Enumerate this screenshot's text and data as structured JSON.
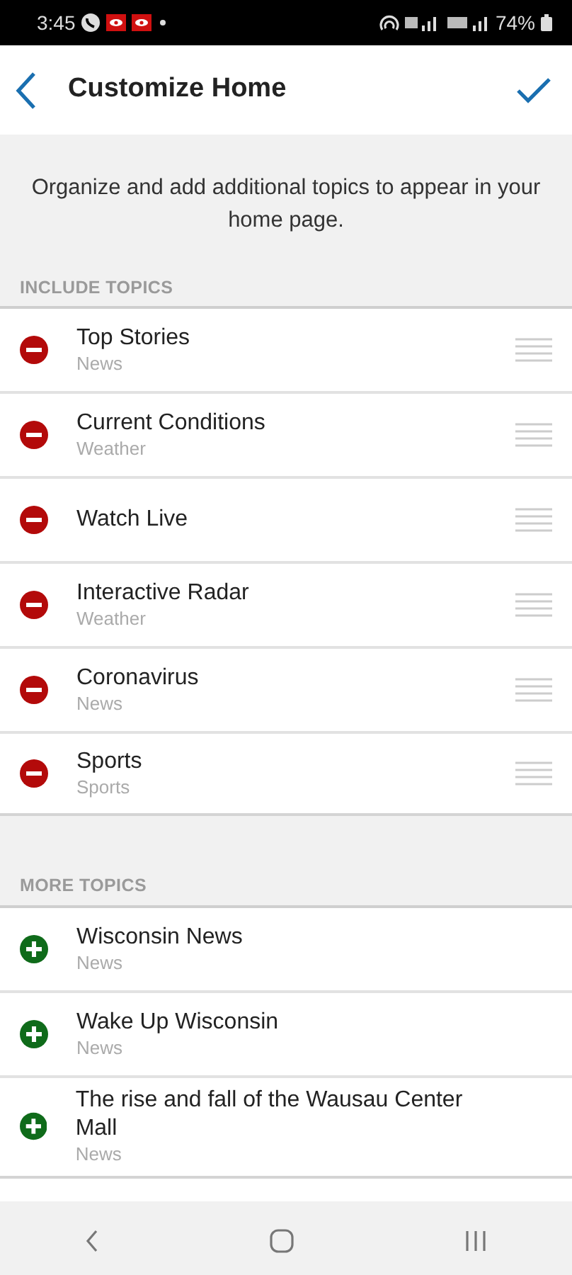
{
  "status_bar": {
    "time": "3:45",
    "battery": "74%"
  },
  "header": {
    "title": "Customize Home"
  },
  "intro": "Organize and add additional topics to appear in your home page.",
  "sections": [
    {
      "kind": "include",
      "title": "INCLUDE TOPICS",
      "items": [
        {
          "title": "Top Stories",
          "category": "News"
        },
        {
          "title": "Current Conditions",
          "category": "Weather"
        },
        {
          "title": "Watch Live"
        },
        {
          "title": "Interactive Radar",
          "category": "Weather"
        },
        {
          "title": "Coronavirus",
          "category": "News"
        },
        {
          "title": "Sports",
          "category": "Sports"
        }
      ]
    },
    {
      "kind": "more",
      "title": "MORE TOPICS",
      "items": [
        {
          "title": "Wisconsin News",
          "category": "News"
        },
        {
          "title": "Wake Up Wisconsin",
          "category": "News"
        },
        {
          "title": "The rise and fall of the Wausau Center Mall",
          "category": "News"
        }
      ]
    }
  ]
}
